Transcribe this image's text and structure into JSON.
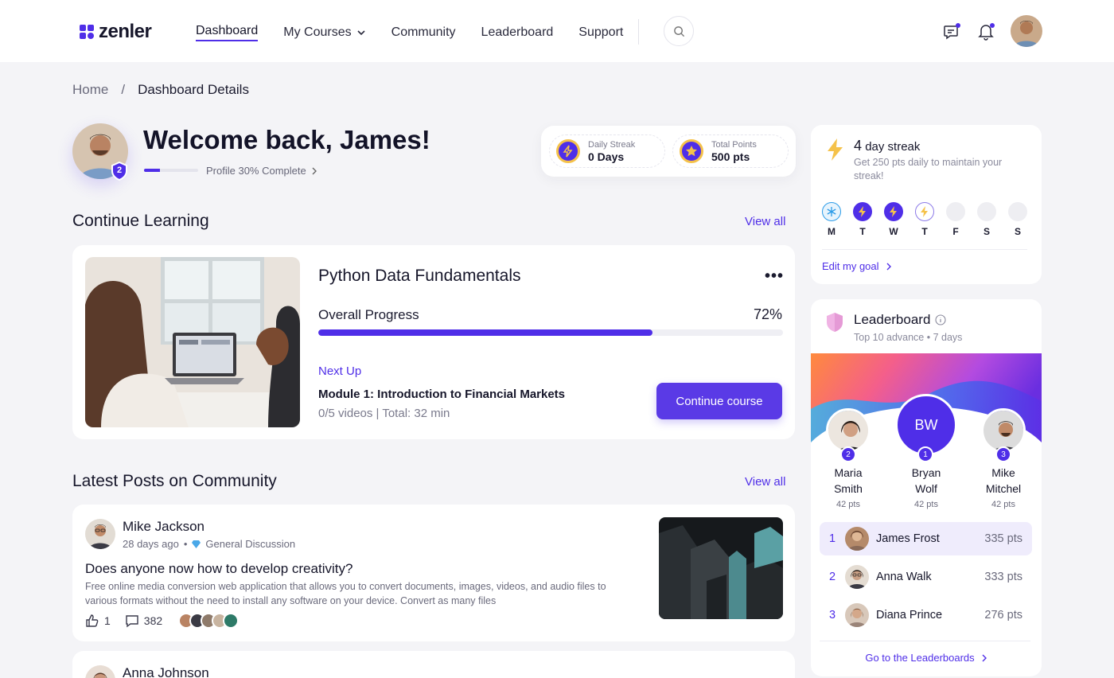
{
  "brand": {
    "name": "zenler",
    "accent": "#4f2ee8"
  },
  "nav": {
    "items": [
      {
        "label": "Dashboard",
        "active": true
      },
      {
        "label": "My Courses",
        "dropdown": true
      },
      {
        "label": "Community"
      },
      {
        "label": "Leaderboard"
      },
      {
        "label": "Support"
      }
    ]
  },
  "header_icons": [
    "search-icon",
    "chat-icon",
    "bell-icon",
    "user-avatar"
  ],
  "breadcrumb": {
    "home": "Home",
    "separator": "/",
    "current": "Dashboard Details"
  },
  "welcome": {
    "title": "Welcome back, James!",
    "level": "2",
    "profile_progress": 30,
    "profile_text": "Profile 30% Complete"
  },
  "stats": [
    {
      "label": "Daily Streak",
      "value": "0 Days",
      "icon": "bolt-icon"
    },
    {
      "label": "Total Points",
      "value": "500 pts",
      "icon": "star-icon"
    }
  ],
  "continue_learning": {
    "heading": "Continue Learning",
    "view_all": "View all",
    "course": {
      "title": "Python Data Fundamentals",
      "progress_label": "Overall Progress",
      "progress_value": 72,
      "progress_text": "72%",
      "next_up_label": "Next Up",
      "module_title": "Module 1: Introduction to Financial Markets",
      "module_meta": "0/5 videos | Total: 32 min",
      "button": "Continue course"
    }
  },
  "community": {
    "heading": "Latest Posts on Community",
    "view_all": "View all",
    "posts": [
      {
        "author": "Mike Jackson",
        "time": "28 days ago",
        "separator": "•",
        "category": "General Discussion",
        "title": "Does anyone now how to develop creativity?",
        "body": "Free online media conversion web application that allows you to convert documents, images, videos, and audio files to various formats without the need to install any software on your device. Convert as many files",
        "likes": "1",
        "comments": "382"
      },
      {
        "author": "Anna Johnson"
      }
    ]
  },
  "streak": {
    "count": "4",
    "title_suffix": "day streak",
    "subtitle": "Get 250 pts daily to maintain your streak!",
    "days": [
      {
        "label": "M",
        "state": "freeze"
      },
      {
        "label": "T",
        "state": "done"
      },
      {
        "label": "W",
        "state": "done"
      },
      {
        "label": "T",
        "state": "today"
      },
      {
        "label": "F",
        "state": "empty"
      },
      {
        "label": "S",
        "state": "empty"
      },
      {
        "label": "S",
        "state": "empty"
      }
    ],
    "edit_goal": "Edit my goal"
  },
  "leaderboard": {
    "title": "Leaderboard",
    "subtitle": "Top 10 advance • 7 days",
    "podium": [
      {
        "first": "Maria",
        "last": "Smith",
        "pts": "42 pts",
        "rank": "2"
      },
      {
        "first": "Bryan",
        "last": "Wolf",
        "pts": "42 pts",
        "rank": "1",
        "initials": "BW"
      },
      {
        "first": "Mike",
        "last": "Mitchel",
        "pts": "42 pts",
        "rank": "3"
      }
    ],
    "rows": [
      {
        "rank": "1",
        "name": "James Frost",
        "pts": "335 pts"
      },
      {
        "rank": "2",
        "name": "Anna Walk",
        "pts": "333 pts"
      },
      {
        "rank": "3",
        "name": "Diana Prince",
        "pts": "276 pts"
      }
    ],
    "link": "Go to the Leaderboards"
  }
}
